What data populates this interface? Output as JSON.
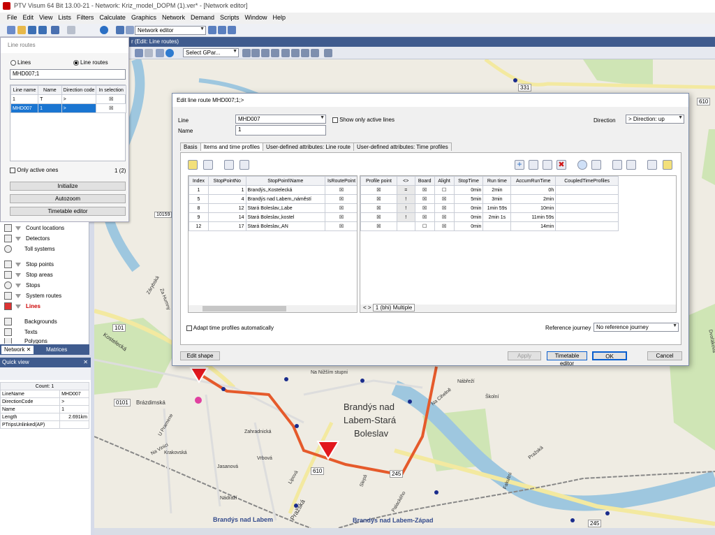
{
  "window": {
    "title": "PTV Visum 64 Bit 13.00-21 - Network: Kriz_model_DOPM (1).ver* - [Network editor]"
  },
  "menu": [
    "File",
    "Edit",
    "View",
    "Lists",
    "Filters",
    "Calculate",
    "Graphics",
    "Network",
    "Demand",
    "Scripts",
    "Window",
    "Help"
  ],
  "toolbar": {
    "mode_combo": "Network editor",
    "gpar_combo": "Select GPar..."
  },
  "map_header": "r (Edit: Line routes)",
  "line_routes_panel": {
    "title": "Line routes",
    "radio_lines": "Lines",
    "radio_line_routes": "Line routes",
    "search_value": "MHD007;1",
    "columns": [
      "Line name",
      "Name",
      "Direction code",
      "In selection"
    ],
    "rows": [
      {
        "line": "1",
        "name": "T",
        "dir": ">",
        "sel": "☒"
      },
      {
        "line": "MHD007",
        "name": "1",
        "dir": ">",
        "sel": "☒"
      }
    ],
    "only_active": "Only active ones",
    "count": "1 (2)",
    "btn_initialize": "Initialize",
    "btn_autozoom": "Autozoom",
    "btn_timetable": "Timetable editor"
  },
  "side_list": {
    "items": [
      "Count locations",
      "Detectors",
      "Toll systems",
      "Stop points",
      "Stop areas",
      "Stops",
      "System routes",
      "Lines",
      "Backgrounds",
      "Texts",
      "Polygons"
    ]
  },
  "bottom_tabs": {
    "network": "Network",
    "matrices": "Matrices"
  },
  "quick_view": {
    "title": "Quick view",
    "count": "Count: 1",
    "rows": [
      {
        "k": "LineName",
        "v": "MHD007"
      },
      {
        "k": "DirectionCode",
        "v": ">"
      },
      {
        "k": "Name",
        "v": "1"
      },
      {
        "k": "Length",
        "v": "2.691km"
      },
      {
        "k": "PTripsUnlinked(AP)",
        "v": ""
      }
    ]
  },
  "dialog": {
    "title": "Edit line route MHD007;1;>",
    "line_label": "Line",
    "line_value": "MHD007",
    "show_active": "Show only active lines",
    "direction_label": "Direction",
    "direction_value": "> Direction: up",
    "name_label": "Name",
    "name_value": "1",
    "tabs": [
      "Basis",
      "Items and time profiles",
      "User-defined attributes: Line route",
      "User-defined attributes: Time profiles"
    ],
    "left_columns": [
      "Index",
      "StopPointNo",
      "StopPoint\\Name",
      "IsRoutePoint"
    ],
    "left_rows": [
      {
        "i": "1",
        "no": "1",
        "name": "Brandýs,,Kostelecká",
        "rp": "☒"
      },
      {
        "i": "5",
        "no": "4",
        "name": "Brandýs nad Labem,,náměstí",
        "rp": "☒"
      },
      {
        "i": "8",
        "no": "12",
        "name": "Stará Boleslav,,Labe",
        "rp": "☒"
      },
      {
        "i": "9",
        "no": "14",
        "name": "Stará Boleslav,,kostel",
        "rp": "☒"
      },
      {
        "i": "12",
        "no": "17",
        "name": "Stará Boleslav,,AN",
        "rp": "☒"
      }
    ],
    "right_columns": [
      "Profile point",
      "<>",
      "Board",
      "Alight",
      "StopTime",
      "Run time",
      "AccumRunTime",
      "CoupledTimeProfiles"
    ],
    "right_rows": [
      {
        "pp": "☒",
        "cmp": "=",
        "board": "☒",
        "alight": "☐",
        "stop": "0min",
        "run": "2min",
        "accum": "0h"
      },
      {
        "pp": "☒",
        "cmp": "!",
        "board": "☒",
        "alight": "☒",
        "stop": "5min",
        "run": "3min",
        "accum": "2min"
      },
      {
        "pp": "☒",
        "cmp": "!",
        "board": "☒",
        "alight": "☒",
        "stop": "0min",
        "run": "1min 59s",
        "accum": "10min"
      },
      {
        "pp": "☒",
        "cmp": "!",
        "board": "☒",
        "alight": "☒",
        "stop": "0min",
        "run": "2min 1s",
        "accum": "11min 59s"
      },
      {
        "pp": "☒",
        "cmp": "",
        "board": "☐",
        "alight": "☒",
        "stop": "0min",
        "run": "",
        "accum": "14min"
      }
    ],
    "profile_tab": "1 (bhi) Multiple",
    "adapt_label": "Adapt time profiles automatically",
    "reference_label": "Reference journey",
    "reference_value": "No reference journey",
    "btn_edit_shape": "Edit shape",
    "btn_apply": "Apply",
    "btn_timetable": "Timetable editor",
    "btn_ok": "OK",
    "btn_cancel": "Cancel"
  },
  "map_labels": {
    "town1": "Brandýs nad",
    "town2": "Labem-Stará",
    "town3": "Boleslav",
    "station1": "Brandýs nad Labem",
    "station2": "Brandýs nad Labem-Západ",
    "streets": [
      "Kostelecká",
      "Brázdimská",
      "Na Nižším stupni",
      "Zahradnická",
      "Jasanová",
      "Krakovská",
      "Lipová",
      "Pražská",
      "Nádraží",
      "Zárybská",
      "Na Cihelně",
      "Dvořákova",
      "Nábřeží",
      "Fakultní",
      "Palackého",
      "Slepá",
      "Vrbová",
      "Za Humny",
      "U Pramene",
      "Školní",
      "Na Vinici",
      "Pražská"
    ],
    "road_numbers": [
      "331",
      "610",
      "101",
      "0101",
      "610",
      "245",
      "245",
      "10159"
    ]
  },
  "colors": {
    "accent": "#3f5b8e",
    "route": "#e55a2b",
    "road": "#f3e9a0",
    "river": "#9ec7df",
    "park": "#cfe5b5"
  }
}
